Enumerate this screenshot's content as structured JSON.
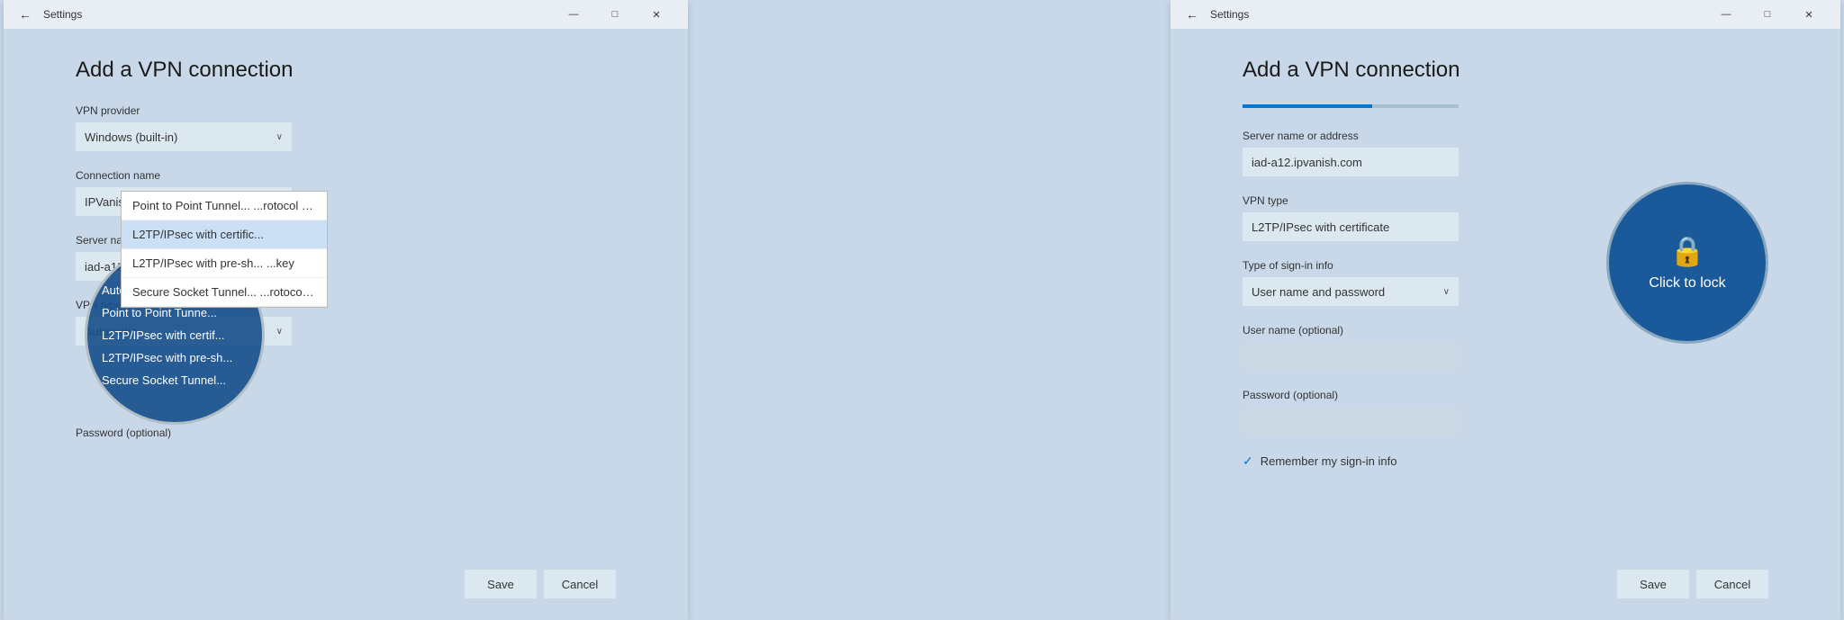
{
  "left_window": {
    "title": "Settings",
    "page_title": "Add a VPN connection",
    "fields": {
      "vpn_provider_label": "VPN provider",
      "vpn_provider_value": "Windows (built-in)",
      "connection_name_label": "Connection name",
      "connection_name_value": "IPVanish Ashburn",
      "server_label": "Server name or address",
      "server_value": "iad-a12.ipvanish.com",
      "vpn_type_label": "VPN type",
      "vpn_type_value": "Automatic",
      "password_label": "Password (optional)"
    },
    "dropdown_items": [
      "Point to Point Tunnel... ...rotocol (PPTP)",
      "L2TP/IPsec with certific...",
      "L2TP/IPsec with pre-sh... ...key",
      "Secure Socket Tunnel... ...rotocol (SSTP)"
    ],
    "buttons": {
      "save": "Save",
      "cancel": "Cancel"
    }
  },
  "right_window": {
    "title": "Settings",
    "page_title": "Add a VPN connection",
    "progress": 60,
    "fields": {
      "server_label": "Server name or address",
      "server_value": "iad-a12.ipvanish.com",
      "vpn_type_label": "VPN type",
      "vpn_type_value": "L2TP/IPsec with certificate",
      "sign_in_label": "Type of sign-in info",
      "sign_in_value": "User name and password",
      "username_label": "User name (optional)",
      "username_value": "",
      "password_label": "Password (optional)",
      "password_value": "",
      "remember_label": "Remember my sign-in info"
    },
    "lock_button": {
      "text": "Click to lock"
    },
    "buttons": {
      "save": "Save",
      "cancel": "Cancel"
    }
  },
  "icons": {
    "back": "←",
    "minimize": "—",
    "maximize": "□",
    "close": "✕",
    "dropdown_arrow": "∨",
    "check": "✓",
    "lock": "🔒"
  }
}
